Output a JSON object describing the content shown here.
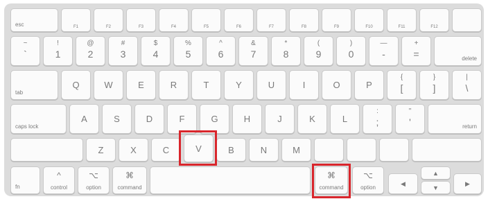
{
  "keyboard": {
    "fn_row": {
      "esc": "esc",
      "f": [
        "F1",
        "F2",
        "F3",
        "F4",
        "F5",
        "F6",
        "F7",
        "F8",
        "F9",
        "F10",
        "F11",
        "F12"
      ]
    },
    "num_row": {
      "keys": [
        {
          "top": "~",
          "bottom": "`"
        },
        {
          "top": "!",
          "bottom": "1"
        },
        {
          "top": "@",
          "bottom": "2"
        },
        {
          "top": "#",
          "bottom": "3"
        },
        {
          "top": "$",
          "bottom": "4"
        },
        {
          "top": "%",
          "bottom": "5"
        },
        {
          "top": "^",
          "bottom": "6"
        },
        {
          "top": "&",
          "bottom": "7"
        },
        {
          "top": "*",
          "bottom": "8"
        },
        {
          "top": "(",
          "bottom": "9"
        },
        {
          "top": ")",
          "bottom": "0"
        },
        {
          "top": "—",
          "bottom": "-"
        },
        {
          "top": "+",
          "bottom": "="
        }
      ],
      "delete": "delete"
    },
    "top_row": {
      "tab": "tab",
      "letters": [
        "Q",
        "W",
        "E",
        "R",
        "T",
        "Y",
        "U",
        "I",
        "O",
        "P"
      ],
      "brackets": [
        {
          "top": "{",
          "bottom": "["
        },
        {
          "top": "}",
          "bottom": "]"
        },
        {
          "top": "|",
          "bottom": "\\"
        }
      ]
    },
    "home_row": {
      "caps": "caps lock",
      "letters": [
        "A",
        "S",
        "D",
        "F",
        "G",
        "H",
        "J",
        "K",
        "L"
      ],
      "semicolon": {
        "top": ":",
        "bottom": ";"
      },
      "quote": {
        "top": "\"",
        "bottom": "'"
      },
      "return": "return"
    },
    "bottom_row": {
      "letters": [
        "Z",
        "X",
        "C",
        "V",
        "B",
        "N",
        "M"
      ]
    },
    "mod_row": {
      "fn": "fn",
      "control": {
        "icon": "^",
        "label": "control"
      },
      "option": {
        "icon": "⌥",
        "label": "option"
      },
      "command": {
        "icon": "⌘",
        "label": "command"
      },
      "command_right": {
        "icon": "⌘",
        "label": "command"
      },
      "option_right": {
        "icon": "⌥",
        "label": "option"
      },
      "arrows": {
        "left": "◀",
        "up": "▲",
        "down": "▼",
        "right": "▶"
      }
    }
  },
  "highlight_color": "#d9262c"
}
